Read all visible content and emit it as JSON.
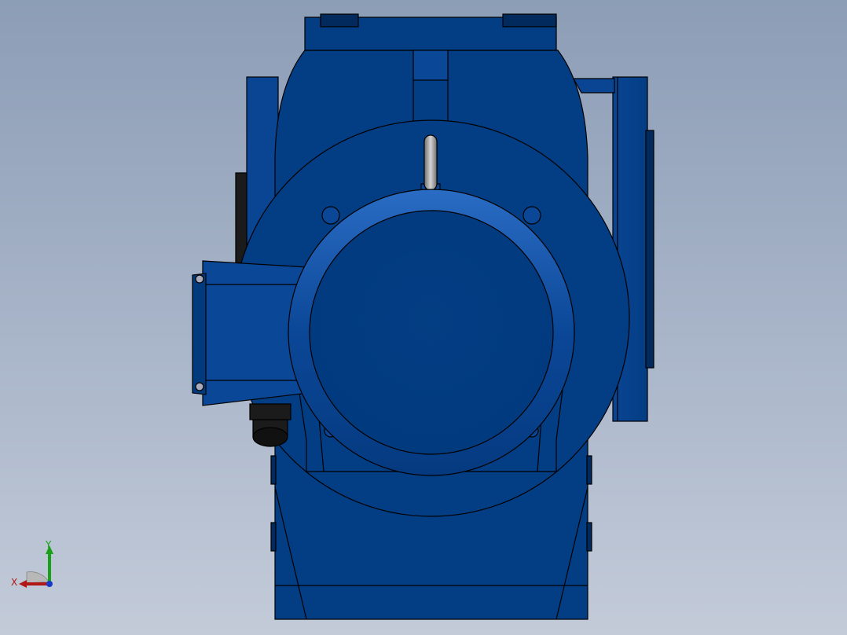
{
  "viewport": {
    "background_top": "#8c9db6",
    "background_bottom": "#c3cbd9"
  },
  "model": {
    "body_color": "#033d83",
    "body_light": "#1a5cb0",
    "body_dark": "#022a5c",
    "edge_color": "#000000",
    "lift_eye_color": "#8e8e8e",
    "cable_gland_color": "#1a1a1a"
  },
  "triad": {
    "x_label": "X",
    "y_label": "Y",
    "x_color": "#b01818",
    "y_color": "#18a018",
    "z_color": "#1838c8"
  }
}
